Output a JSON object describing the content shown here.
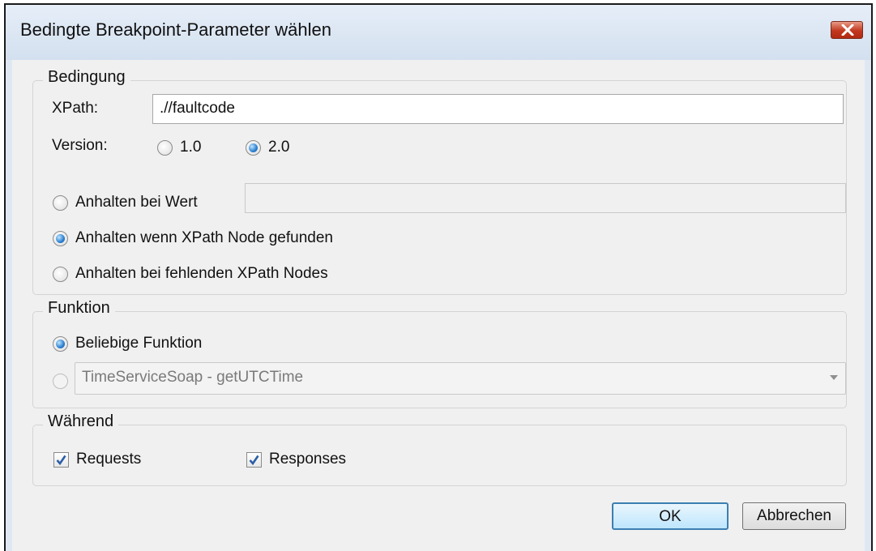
{
  "dialog": {
    "title": "Bedingte Breakpoint-Parameter wählen"
  },
  "condition": {
    "legend": "Bedingung",
    "xpath_label": "XPath:",
    "xpath_value": ".//faultcode",
    "version_label": "Version:",
    "version_options": [
      "1.0",
      "2.0"
    ],
    "version_selected": "2.0",
    "stop_at_value_label": "Anhalten bei Wert",
    "stop_at_value_input": "",
    "stop_when_found_label": "Anhalten wenn XPath Node gefunden",
    "stop_when_missing_label": "Anhalten bei fehlenden XPath Nodes",
    "selected_mode": "Anhalten wenn XPath Node gefunden"
  },
  "function": {
    "legend": "Funktion",
    "any_label": "Beliebige Funktion",
    "specific_value": "TimeServiceSoap - getUTCTime",
    "selected": "Beliebige Funktion"
  },
  "during": {
    "legend": "Während",
    "requests_label": "Requests",
    "requests_checked": true,
    "responses_label": "Responses",
    "responses_checked": true
  },
  "buttons": {
    "ok": "OK",
    "cancel": "Abbrechen"
  },
  "icons": {
    "close": "close-x-icon",
    "dropdown": "chevron-down-icon",
    "check": "checkmark-icon"
  },
  "colors": {
    "title_bar": "#dfe8f2",
    "close_button": "#c2381f",
    "radio_selected": "#2c7fd0",
    "ok_border": "#3c7fb1"
  }
}
